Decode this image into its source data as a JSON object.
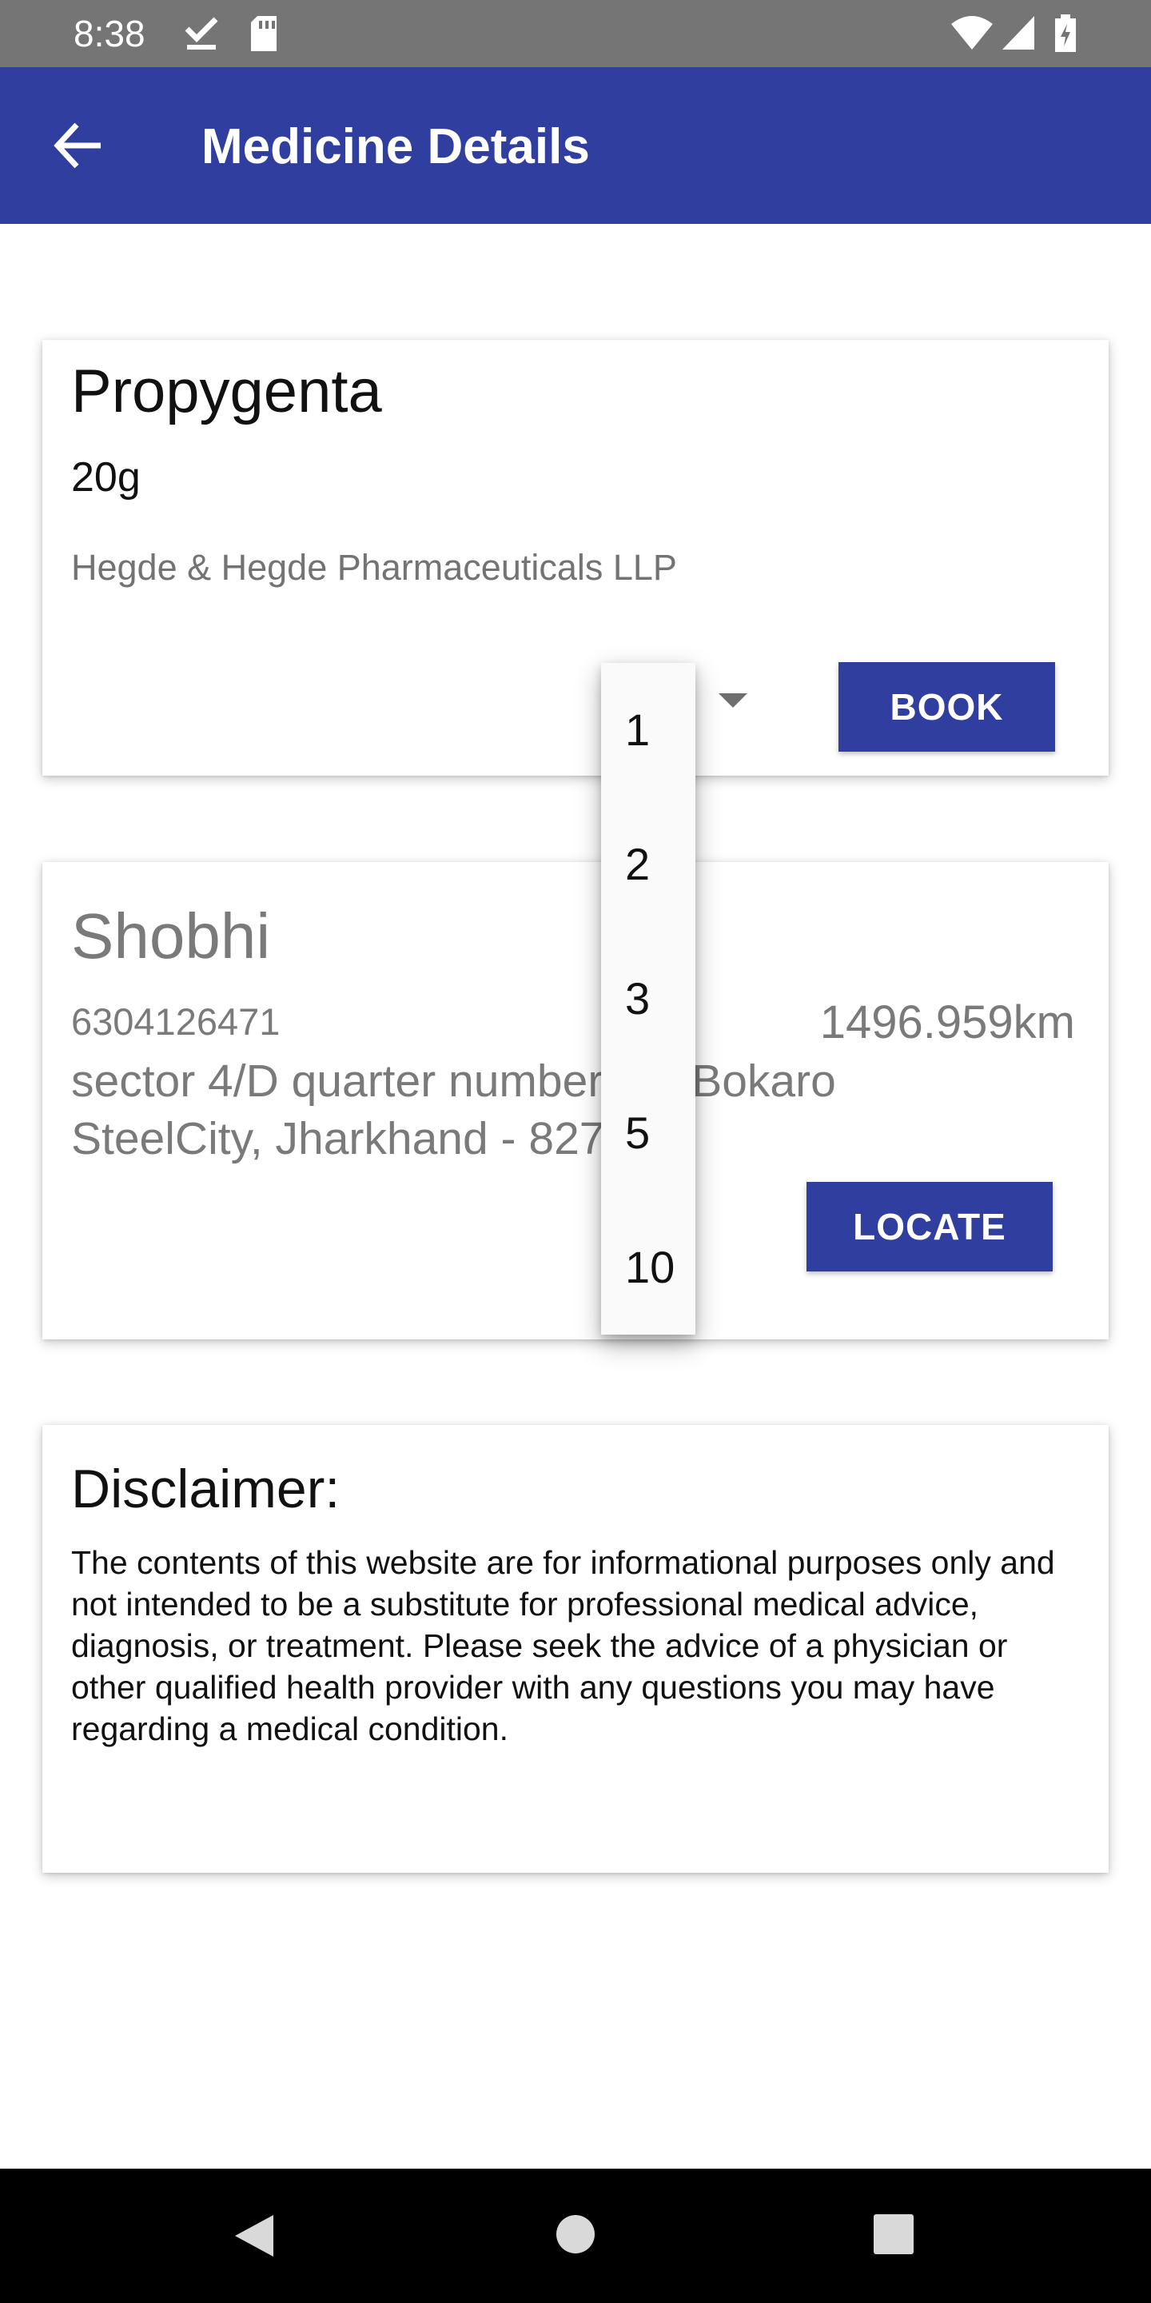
{
  "status_bar": {
    "time": "8:38",
    "icons": [
      "download-done-icon",
      "sd-card-icon",
      "wifi-icon",
      "signal-icon",
      "battery-icon"
    ]
  },
  "app_bar": {
    "title": "Medicine Details",
    "back_icon": "arrow-back-icon",
    "color": "#303f9f"
  },
  "medicine": {
    "name": "Propygenta",
    "quantity": "20g",
    "manufacturer": "Hegde & Hegde Pharmaceuticals LLP",
    "book_label": "BOOK"
  },
  "quantity_dropdown": {
    "options": [
      "1",
      "2",
      "3",
      "5",
      "10"
    ]
  },
  "store": {
    "name": "Shobhi",
    "phone": "6304126471",
    "distance": "1496.959km",
    "address": "sector 4/D quarter number 24, Bokaro SteelCity, Jharkhand - 827004",
    "locate_label": "LOCATE"
  },
  "disclaimer": {
    "title": "Disclaimer:",
    "body": "The contents of this website are for informational purposes only and not intended to be a substitute for professional medical advice, diagnosis, or treatment. Please seek the advice of a physician or other qualified health provider with any questions you may have regarding a medical condition."
  },
  "nav_bar": {
    "icons": [
      "back-triangle-icon",
      "home-circle-icon",
      "recents-square-icon"
    ]
  }
}
